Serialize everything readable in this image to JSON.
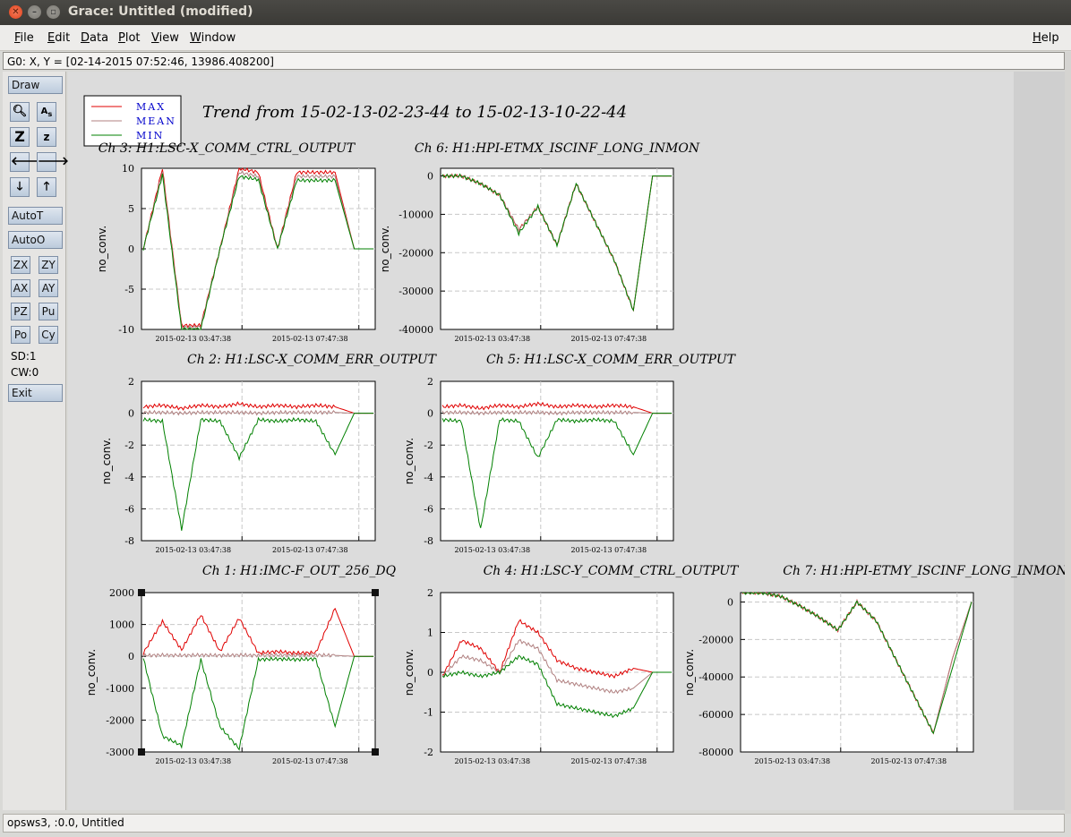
{
  "window": {
    "title": "Grace: Untitled (modified)"
  },
  "menu": {
    "file": "File",
    "edit": "Edit",
    "data": "Data",
    "plot": "Plot",
    "view": "View",
    "window": "Window",
    "help": "Help"
  },
  "locator": "G0: X, Y = [02-14-2015 07:52:46, 13986.408200]",
  "tools": {
    "draw": "Draw",
    "autot": "AutoT",
    "autoo": "AutoO",
    "zx": "ZX",
    "zy": "ZY",
    "ax": "AX",
    "ay": "AY",
    "pz": "PZ",
    "pu": "Pu",
    "po": "Po",
    "cy": "Cy",
    "sd": "SD:1",
    "cw": "CW:0",
    "exit": "Exit",
    "zoom_in_z": "Z",
    "zoom_out_z": "z"
  },
  "status": "opsws3, :0.0, Untitled",
  "canvas": {
    "title": "Trend from 15-02-13-02-23-44 to 15-02-13-10-22-44",
    "legend": [
      {
        "label": "MAX",
        "color": "#e00000"
      },
      {
        "label": "MEAN",
        "color": "#b08080"
      },
      {
        "label": "MIN",
        "color": "#008000"
      }
    ],
    "xtick_labels": [
      "2015-02-13 03:47:38",
      "2015-02-13 07:47:38"
    ]
  },
  "chart_data": [
    {
      "type": "line",
      "title": "Ch 3: H1:LSC-X_COMM_CTRL_OUTPUT",
      "ylabel": "no_conv.",
      "ylim": [
        -10,
        10
      ],
      "yticks": [
        "10",
        "5",
        "0",
        "-5",
        "-10"
      ],
      "series": [
        {
          "name": "MAX",
          "values": [
            0,
            10,
            -9.5,
            -9.5,
            0,
            10,
            9.5,
            0,
            9.5,
            9.5,
            9.5,
            0,
            0
          ]
        },
        {
          "name": "MEAN",
          "values": [
            0,
            9.6,
            -9.7,
            -9.7,
            0,
            9.5,
            9.0,
            0,
            9.0,
            9.0,
            9.0,
            0,
            0
          ]
        },
        {
          "name": "MIN",
          "values": [
            0,
            9.2,
            -10,
            -10,
            0,
            9.0,
            8.6,
            0,
            8.5,
            8.5,
            8.5,
            0,
            0
          ]
        }
      ]
    },
    {
      "type": "line",
      "title": "Ch 6: H1:HPI-ETMX_ISCINF_LONG_INMON",
      "ylabel": "no_conv.",
      "ylim": [
        -40000,
        2000
      ],
      "yticks": [
        "0",
        "-10000",
        "-20000",
        "-30000",
        "-40000"
      ],
      "series": [
        {
          "name": "MAX",
          "values": [
            0,
            0,
            -2000,
            -5000,
            -14000,
            -8000,
            -18000,
            -2000,
            -12000,
            -22000,
            -35000,
            0,
            0
          ]
        },
        {
          "name": "MEAN",
          "values": [
            0,
            0,
            -2000,
            -5000,
            -14000,
            -8000,
            -18000,
            -2000,
            -12000,
            -22000,
            -35000,
            0,
            0
          ]
        },
        {
          "name": "MIN",
          "values": [
            0,
            0,
            -2000,
            -5000,
            -15000,
            -8000,
            -18000,
            -2000,
            -12000,
            -22000,
            -35000,
            0,
            0
          ]
        }
      ]
    },
    {
      "type": "line",
      "title": "Ch 2: H1:LSC-X_COMM_ERR_OUTPUT",
      "ylabel": "no_conv.",
      "ylim": [
        -8,
        2
      ],
      "yticks": [
        "2",
        "0",
        "-2",
        "-4",
        "-6",
        "-8"
      ],
      "series": [
        {
          "name": "MAX",
          "values": [
            0.4,
            0.5,
            0.3,
            0.5,
            0.4,
            0.6,
            0.4,
            0.5,
            0.4,
            0.5,
            0.4,
            0,
            0
          ]
        },
        {
          "name": "MEAN",
          "values": [
            0.05,
            0.05,
            0,
            0.05,
            0.05,
            0.05,
            0,
            0.05,
            0.05,
            0.05,
            0.05,
            0,
            0
          ]
        },
        {
          "name": "MIN",
          "values": [
            -0.4,
            -0.5,
            -7.3,
            -0.4,
            -0.5,
            -2.8,
            -0.4,
            -0.5,
            -0.4,
            -0.5,
            -2.6,
            0,
            0
          ]
        }
      ]
    },
    {
      "type": "line",
      "title": "Ch 5: H1:LSC-X_COMM_ERR_OUTPUT",
      "ylabel": "no_conv.",
      "ylim": [
        -8,
        2
      ],
      "yticks": [
        "2",
        "0",
        "-2",
        "-4",
        "-6",
        "-8"
      ],
      "series": [
        {
          "name": "MAX",
          "values": [
            0.4,
            0.5,
            0.3,
            0.5,
            0.4,
            0.6,
            0.4,
            0.5,
            0.4,
            0.5,
            0.4,
            0,
            0
          ]
        },
        {
          "name": "MEAN",
          "values": [
            0.05,
            0.05,
            0,
            0.05,
            0.05,
            0.05,
            0,
            0.05,
            0.05,
            0.05,
            0.05,
            0,
            0
          ]
        },
        {
          "name": "MIN",
          "values": [
            -0.4,
            -0.5,
            -7.3,
            -0.4,
            -0.5,
            -2.8,
            -0.4,
            -0.5,
            -0.4,
            -0.5,
            -2.6,
            0,
            0
          ]
        }
      ]
    },
    {
      "type": "line",
      "title": "Ch 1: H1:IMC-F_OUT_256_DQ",
      "ylabel": "no_conv.",
      "ylim": [
        -3000,
        2000
      ],
      "yticks": [
        "2000",
        "1000",
        "0",
        "-1000",
        "-2000",
        "-3000"
      ],
      "series": [
        {
          "name": "MAX",
          "values": [
            100,
            1100,
            200,
            1300,
            150,
            1200,
            100,
            150,
            100,
            120,
            1500,
            0,
            0
          ]
        },
        {
          "name": "MEAN",
          "values": [
            30,
            40,
            30,
            40,
            30,
            40,
            30,
            40,
            30,
            40,
            30,
            0,
            0
          ]
        },
        {
          "name": "MIN",
          "values": [
            -50,
            -2500,
            -2800,
            -100,
            -2200,
            -2900,
            -100,
            -80,
            -100,
            -80,
            -2200,
            0,
            0
          ]
        }
      ]
    },
    {
      "type": "line",
      "title": "Ch 4: H1:LSC-Y_COMM_CTRL_OUTPUT",
      "ylabel": "no_conv.",
      "ylim": [
        -2,
        2
      ],
      "yticks": [
        "2",
        "1",
        "0",
        "-1",
        "-2"
      ],
      "series": [
        {
          "name": "MAX",
          "values": [
            -0.1,
            0.8,
            0.6,
            0,
            1.3,
            1.0,
            0.3,
            0.1,
            0,
            -0.1,
            0.1,
            0,
            0
          ]
        },
        {
          "name": "MEAN",
          "values": [
            -0.1,
            0.4,
            0.3,
            0,
            0.8,
            0.6,
            -0.2,
            -0.3,
            -0.4,
            -0.5,
            -0.4,
            0,
            0
          ]
        },
        {
          "name": "MIN",
          "values": [
            -0.1,
            0,
            -0.1,
            0,
            0.4,
            0.2,
            -0.8,
            -0.9,
            -1.0,
            -1.1,
            -0.9,
            0,
            0
          ]
        }
      ]
    },
    {
      "type": "line",
      "title": "Ch 7: H1:HPI-ETMY_ISCINF_LONG_INMON",
      "ylabel": "no_conv.",
      "ylim": [
        -80000,
        5000
      ],
      "yticks": [
        "0",
        "-20000",
        "-40000",
        "-60000",
        "-80000"
      ],
      "series": [
        {
          "name": "MAX",
          "values": [
            5000,
            5000,
            3000,
            -2000,
            -8000,
            -15000,
            0,
            -10000,
            -30000,
            -50000,
            -70000,
            -30000,
            0
          ]
        },
        {
          "name": "MEAN",
          "values": [
            5000,
            5000,
            3000,
            -2000,
            -8000,
            -15000,
            0,
            -10000,
            -30000,
            -50000,
            -70000,
            -30000,
            0
          ]
        },
        {
          "name": "MIN",
          "values": [
            5000,
            5000,
            3000,
            -2000,
            -8000,
            -15000,
            0,
            -10000,
            -30000,
            -50000,
            -70000,
            -35000,
            0
          ]
        }
      ]
    }
  ]
}
